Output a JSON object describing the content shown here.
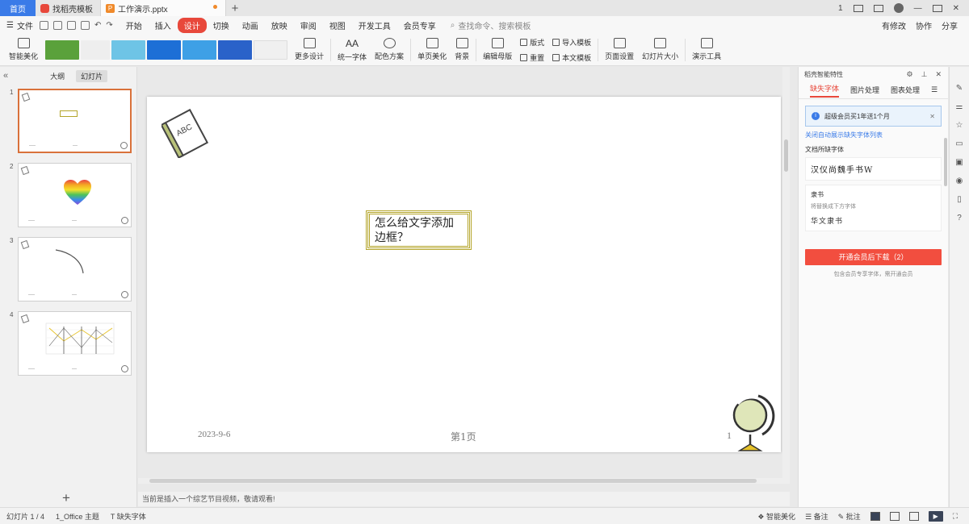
{
  "colors": {
    "accent": "#e8483b",
    "home_tab": "#3a7be8",
    "textbox_border": "#b4a52a",
    "active_slide_border": "#d9713a",
    "download_button": "#f24e3f"
  },
  "titlebar": {
    "home_tab": "首页",
    "tabs": [
      {
        "label": "找稻壳模板",
        "icon": "wps-red-icon"
      },
      {
        "label": "工作演示.pptx",
        "icon": "ppt-orange-icon",
        "unsaved": true
      }
    ],
    "add_tab": "+",
    "controls": [
      "1",
      "restore-icon",
      "grid-icon",
      "avatar",
      "minimize-icon",
      "maximize-icon",
      "close-icon"
    ]
  },
  "menubar": {
    "file": "文件",
    "items": [
      "开始",
      "插入",
      "设计",
      "切换",
      "动画",
      "放映",
      "审阅",
      "视图",
      "开发工具",
      "会员专享"
    ],
    "active_item": "设计",
    "search_placeholder": "查找命令、搜索模板",
    "right": [
      "有修改",
      "协作",
      "分享"
    ]
  },
  "ribbon": {
    "smart_beautify": "智能美化",
    "more_design": "更多设计",
    "unify_font": "统一字体",
    "color_scheme": "配色方案",
    "single_page_beautify": "单页美化",
    "background": "背景",
    "edit_master": "编辑母版",
    "layout": "版式",
    "reset": "重置",
    "import_template": "导入模板",
    "this_template": "本文模板",
    "page_setup": "页面设置",
    "slide_size": "幻灯片大小",
    "presentation_tools": "演示工具"
  },
  "left_panel": {
    "view_tabs": [
      "大纲",
      "幻灯片"
    ],
    "active_view": "幻灯片",
    "slides": [
      {
        "num": "1",
        "content": "textbox"
      },
      {
        "num": "2",
        "content": "heart"
      },
      {
        "num": "3",
        "content": "arc"
      },
      {
        "num": "4",
        "content": "chart"
      }
    ],
    "add_button": "+"
  },
  "slide": {
    "text": "怎么给文字添加边框？",
    "date": "2023-9-6",
    "page_label": "第1页",
    "page_number": "1"
  },
  "hint": "当前是插入一个综艺节目视频，敬请观看!",
  "right_panel": {
    "title": "稻壳智能特性",
    "tabs": [
      "缺失字体",
      "图片处理",
      "图表处理"
    ],
    "active_tab": "缺失字体",
    "notice": "超级会员买1年送1个月",
    "link": "关闭自动展示缺失字体列表",
    "doc_fonts_label": "文档所缺字体",
    "missing_font_preview": "汉仪尚魏手书W",
    "font_name": "隶书",
    "replace_hint": "将替换成下方字体",
    "replace_preview": "华文隶书",
    "download_button": "开通会员后下载（2）",
    "download_note": "包含会员专享字体，需开通会员"
  },
  "right_bar_icons": [
    "pin-icon",
    "sliders-icon",
    "star-icon",
    "comment-icon",
    "image-icon",
    "location-icon",
    "book-icon",
    "help-icon"
  ],
  "statusbar": {
    "slide_count": "幻灯片 1 / 4",
    "theme": "1_Office 主题",
    "missing_font": "缺失字体",
    "smart_beautify": "智能美化",
    "notes": "备注",
    "comments": "批注"
  }
}
